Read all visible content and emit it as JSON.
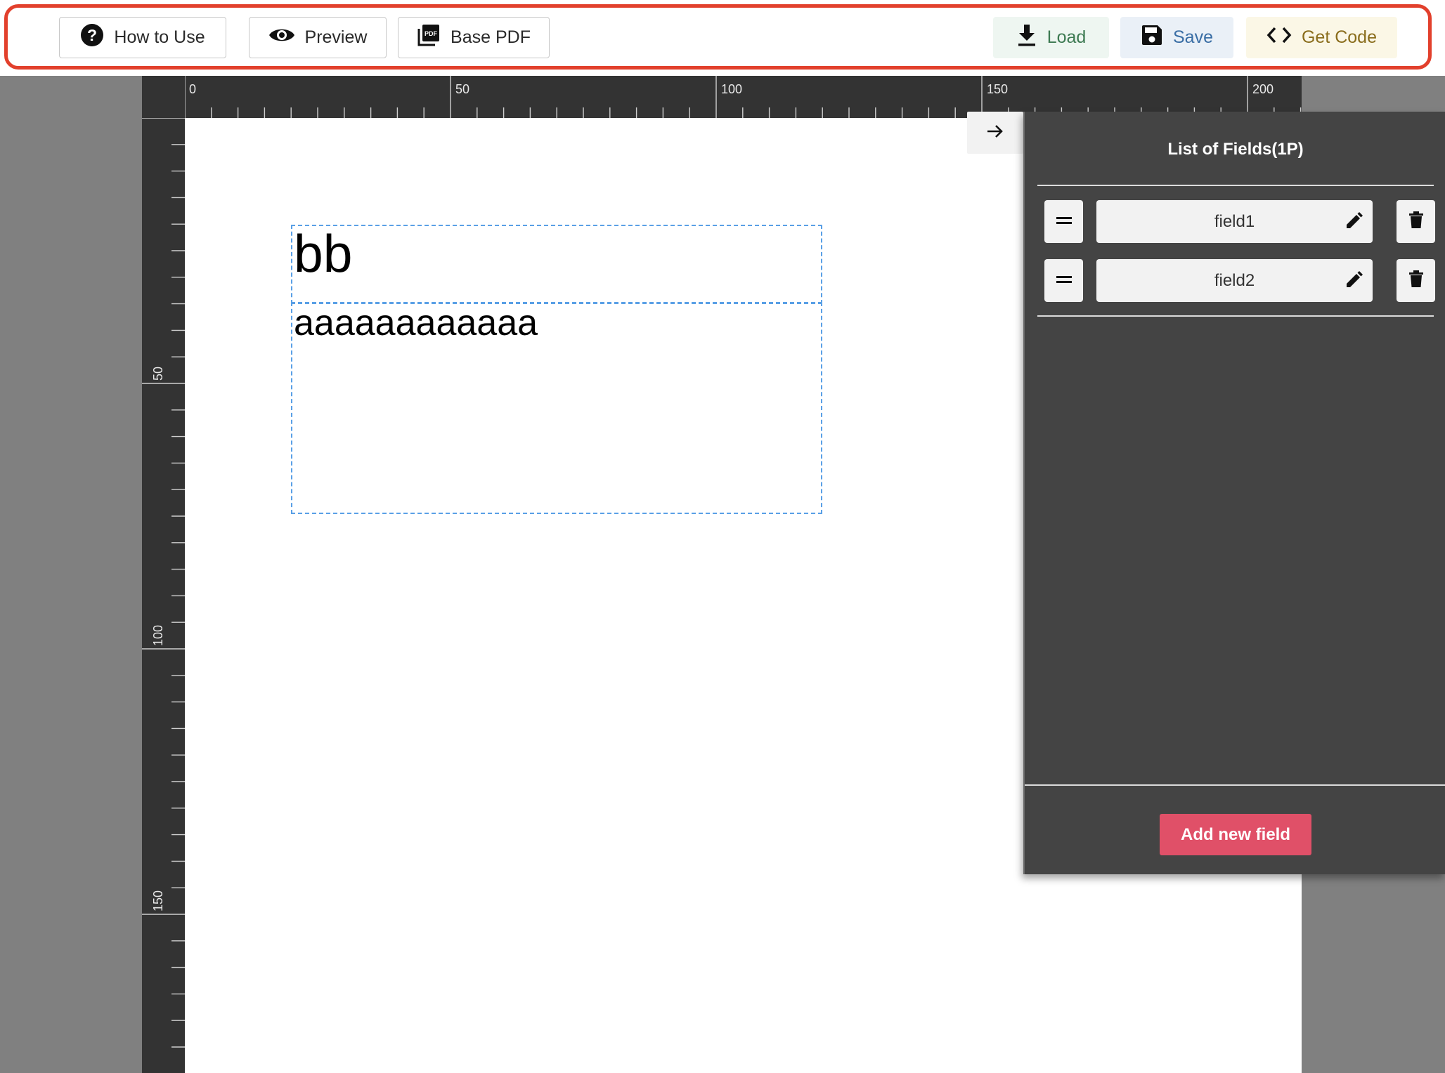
{
  "toolbar": {
    "how_to_use": "How to Use",
    "preview": "Preview",
    "base_pdf": "Base PDF",
    "load": "Load",
    "save": "Save",
    "get_code": "Get Code"
  },
  "ruler": {
    "top_labels": [
      "0",
      "50",
      "100",
      "150",
      "200"
    ],
    "left_labels": [
      "50",
      "100",
      "150"
    ]
  },
  "page": {
    "fields": [
      {
        "name": "field1",
        "content": "bb"
      },
      {
        "name": "field2",
        "content": "aaaaaaaaaaaa"
      }
    ]
  },
  "sidebar": {
    "title": "List of Fields(1P)",
    "items": [
      {
        "label": "field1"
      },
      {
        "label": "field2"
      }
    ],
    "add_button": "Add new field"
  },
  "colors": {
    "highlight": "#e2402c",
    "add_button": "#e05068",
    "sidebar_bg": "#444444",
    "ruler_bg": "#333333",
    "schema_border": "#5aa0e6"
  }
}
